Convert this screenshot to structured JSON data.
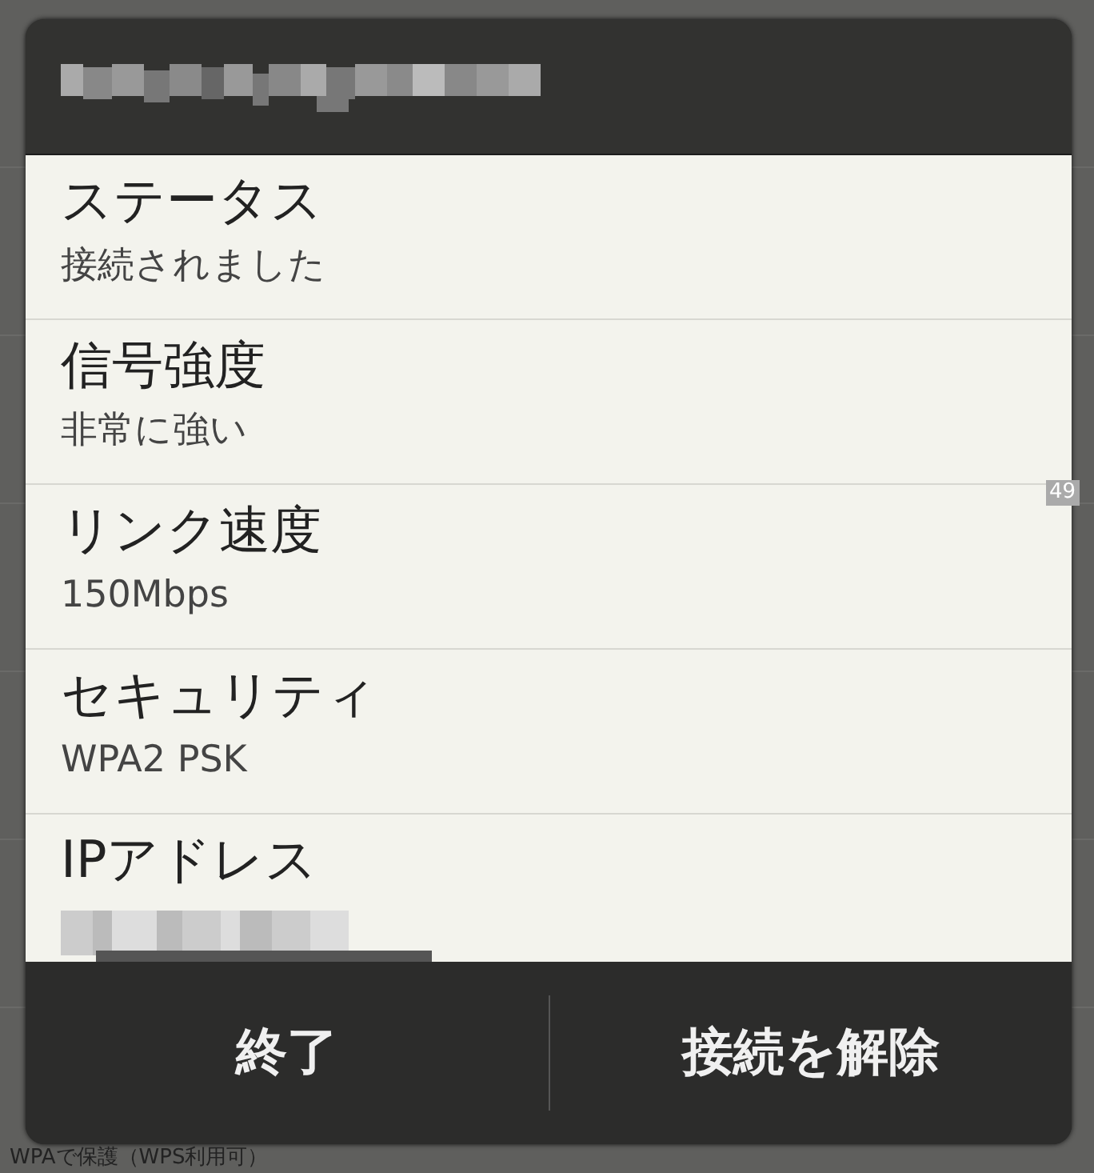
{
  "dialog": {
    "rows": [
      {
        "label": "ステータス",
        "value": "接続されました"
      },
      {
        "label": "信号強度",
        "value": "非常に強い"
      },
      {
        "label": "リンク速度",
        "value": "150Mbps"
      },
      {
        "label": "セキュリティ",
        "value": "WPA2 PSK"
      },
      {
        "label": "IPアドレス",
        "kind": "blurred"
      }
    ],
    "buttons": [
      "終了",
      "接続を解除"
    ]
  },
  "badge": "49",
  "background_text": "WPAで保護（WPS利用可）"
}
